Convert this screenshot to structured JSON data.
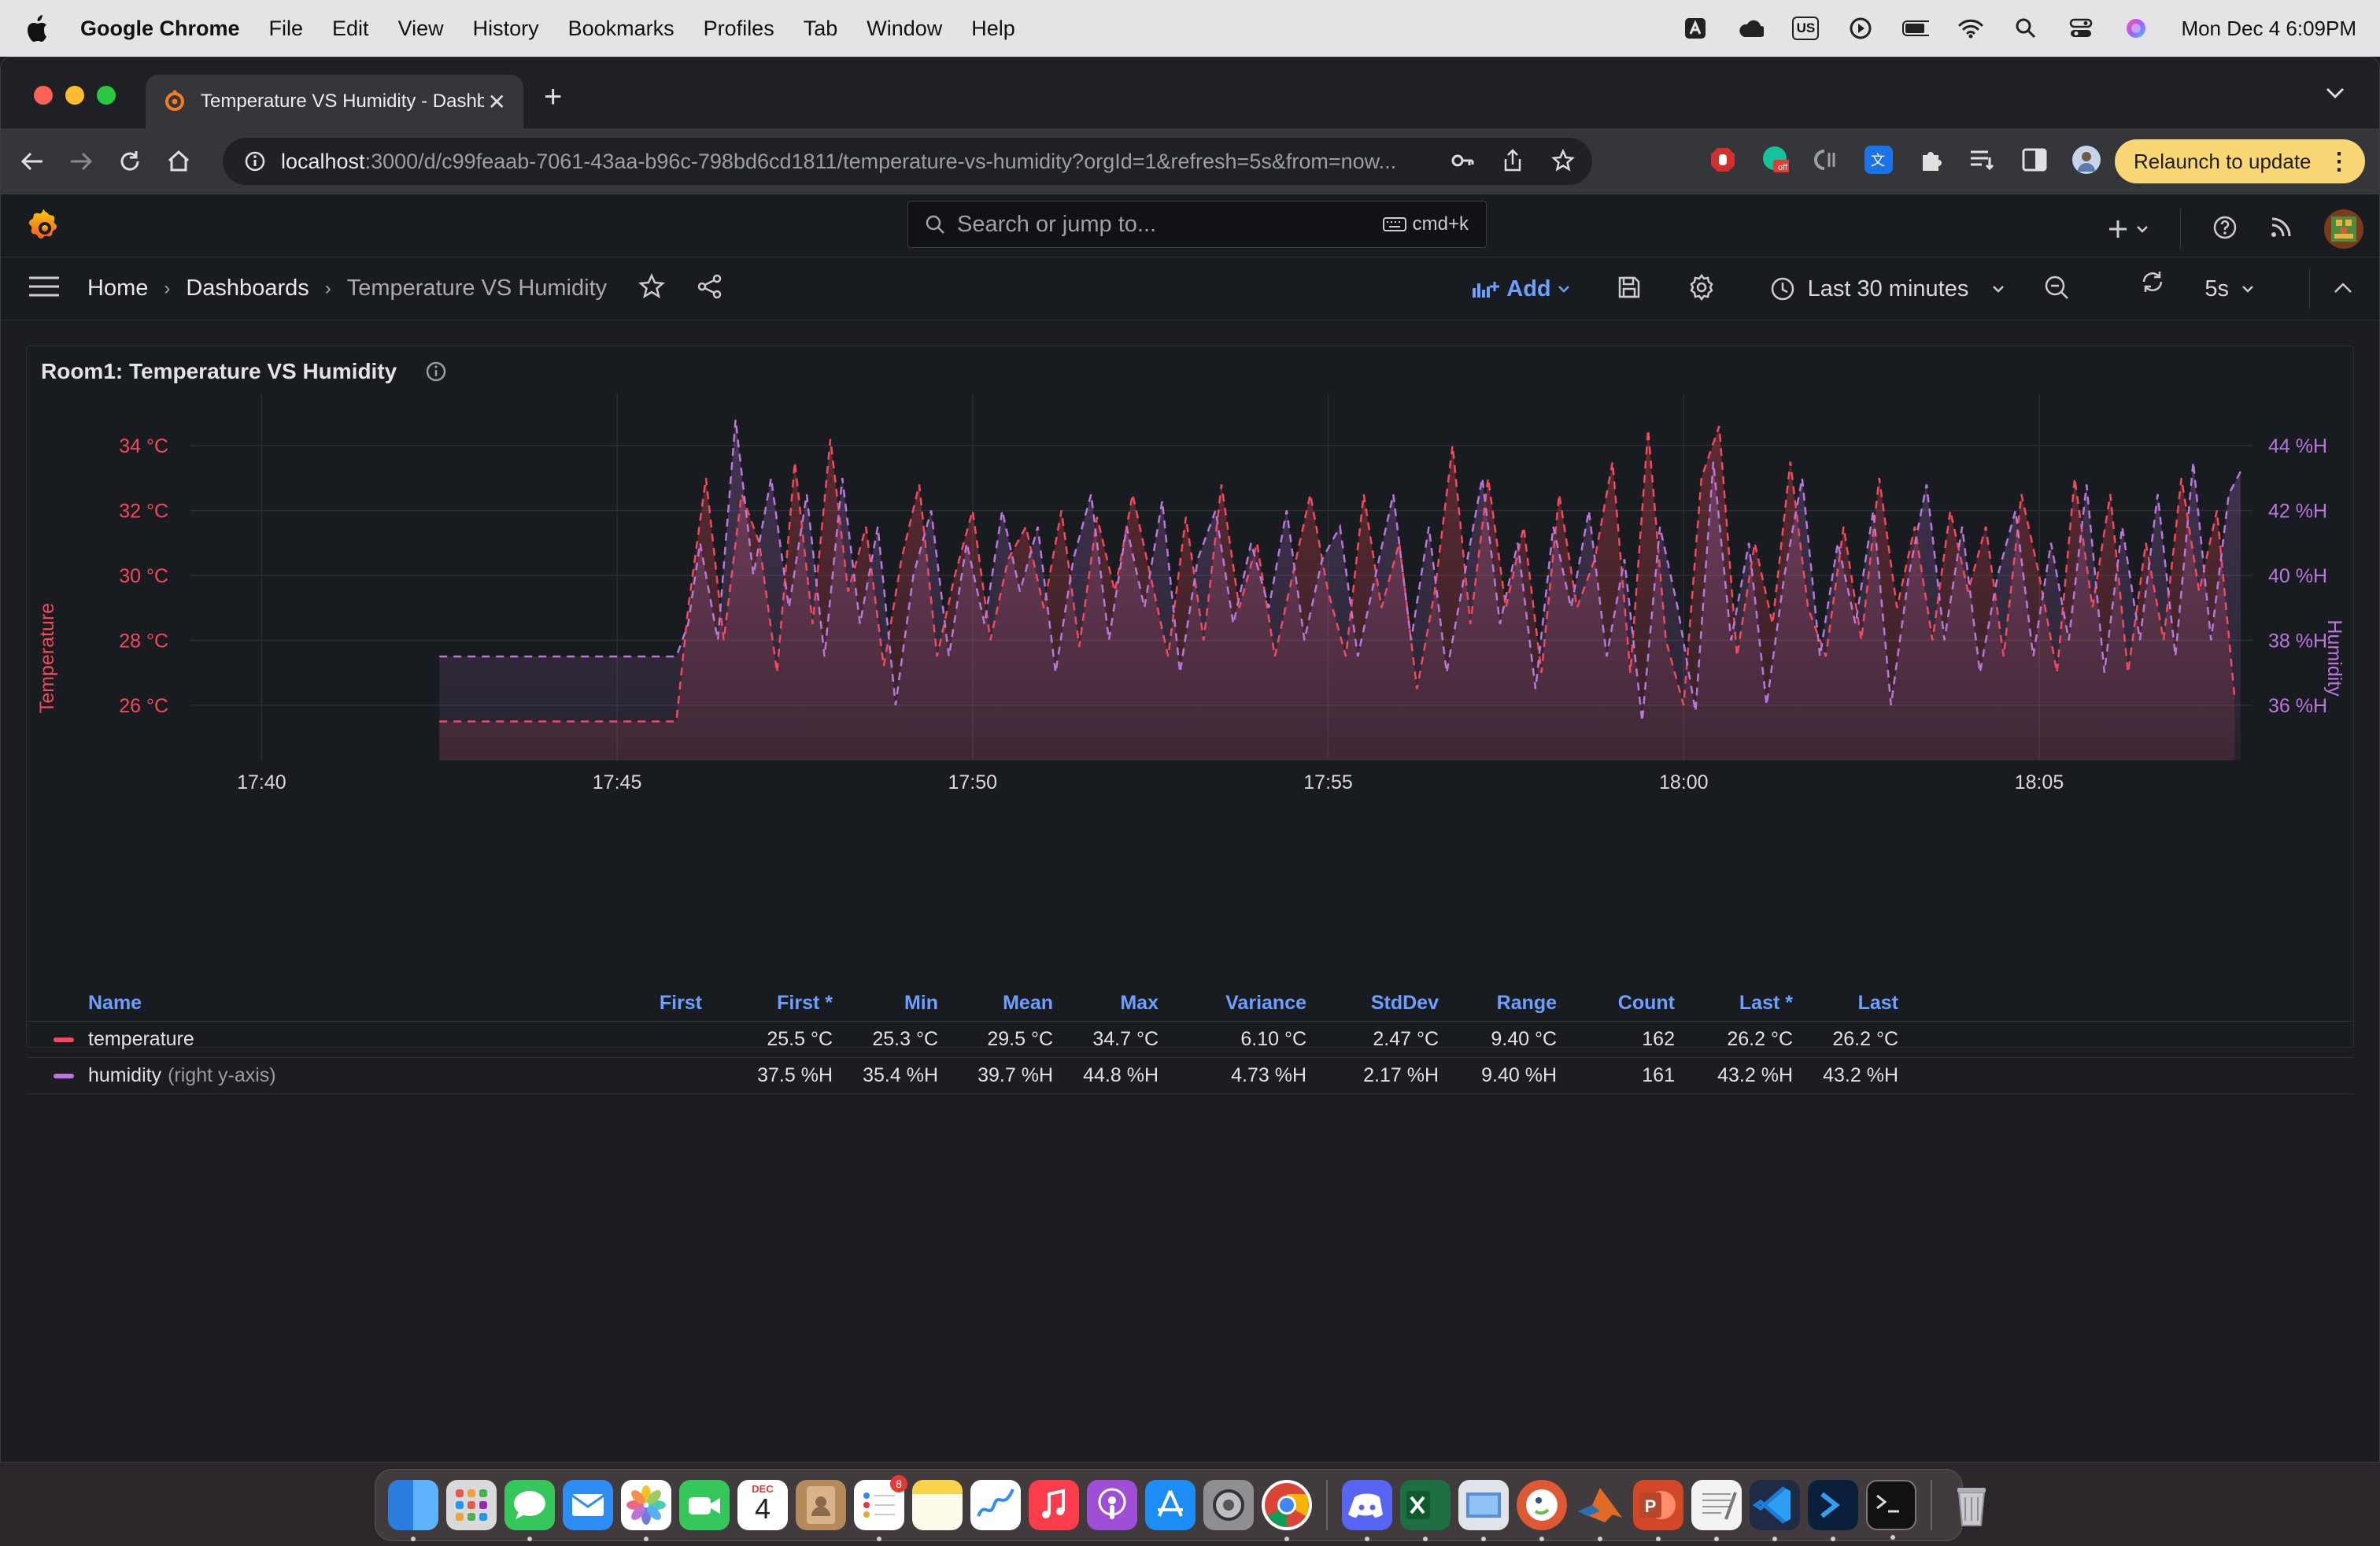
{
  "menubar": {
    "app_name": "Google Chrome",
    "items": [
      "File",
      "Edit",
      "View",
      "History",
      "Bookmarks",
      "Profiles",
      "Tab",
      "Window",
      "Help"
    ],
    "keyboard_layout": "US",
    "clock": "Mon Dec 4  6:09PM"
  },
  "browser": {
    "tab_title": "Temperature VS Humidity - Dashboards - Grafana",
    "url_host": "localhost",
    "url_rest": ":3000/d/c99feaab-7061-43aa-b96c-798bd6cd1811/temperature-vs-humidity?orgId=1&refresh=5s&from=now...",
    "relaunch_label": "Relaunch to update"
  },
  "grafana": {
    "search_placeholder": "Search or jump to...",
    "search_shortcut": "cmd+k",
    "breadcrumb": {
      "home": "Home",
      "dashboards": "Dashboards",
      "current": "Temperature VS Humidity"
    },
    "add_label": "Add",
    "time_range": "Last 30 minutes",
    "refresh_interval": "5s"
  },
  "panel": {
    "title": "Room1: Temperature VS Humidity"
  },
  "chart_data": {
    "type": "line",
    "left_axis": {
      "label": "Temperature",
      "ticks": [
        "34 °C",
        "32 °C",
        "30 °C",
        "28 °C",
        "26 °C"
      ],
      "tick_values": [
        34,
        32,
        30,
        28,
        26
      ],
      "range": [
        24.3,
        35.6
      ]
    },
    "right_axis": {
      "label": "Humidity",
      "ticks": [
        "44 %H",
        "42 %H",
        "40 %H",
        "38 %H",
        "36 %H"
      ],
      "tick_values": [
        44,
        42,
        40,
        38,
        36
      ],
      "range": [
        34.3,
        45.6
      ]
    },
    "x_ticks": [
      "17:40",
      "17:45",
      "17:50",
      "17:55",
      "18:00",
      "18:05"
    ],
    "x_range_minutes": [
      "17:39",
      "18:08"
    ],
    "legend_placement": "bottom",
    "series": [
      {
        "name": "temperature",
        "color": "#f2495c",
        "style": "dashed",
        "axis": "left",
        "points": [
          [
            "17:42:30",
            25.5
          ],
          [
            "17:45:50",
            25.5
          ],
          [
            "17:46:00",
            29.0
          ],
          [
            "17:46:15",
            33.0
          ],
          [
            "17:46:30",
            28.0
          ],
          [
            "17:46:45",
            32.5
          ],
          [
            "17:47:00",
            31.0
          ],
          [
            "17:47:15",
            27.0
          ],
          [
            "17:47:30",
            33.5
          ],
          [
            "17:47:45",
            28.5
          ],
          [
            "17:48:00",
            34.2
          ],
          [
            "17:48:15",
            29.5
          ],
          [
            "17:48:30",
            31.5
          ],
          [
            "17:48:45",
            27.2
          ],
          [
            "17:49:00",
            30.5
          ],
          [
            "17:49:15",
            32.8
          ],
          [
            "17:49:30",
            27.5
          ],
          [
            "17:49:45",
            30.0
          ],
          [
            "17:50:00",
            32.0
          ],
          [
            "17:50:15",
            28.0
          ],
          [
            "17:50:30",
            30.5
          ],
          [
            "17:50:45",
            31.5
          ],
          [
            "17:51:00",
            29.0
          ],
          [
            "17:51:15",
            32.0
          ],
          [
            "17:51:30",
            27.8
          ],
          [
            "17:51:45",
            31.8
          ],
          [
            "17:52:00",
            29.5
          ],
          [
            "17:52:15",
            32.5
          ],
          [
            "17:52:30",
            30.0
          ],
          [
            "17:52:45",
            27.5
          ],
          [
            "17:53:00",
            31.8
          ],
          [
            "17:53:15",
            28.0
          ],
          [
            "17:53:30",
            32.8
          ],
          [
            "17:53:45",
            29.0
          ],
          [
            "17:54:00",
            31.0
          ],
          [
            "17:54:15",
            27.5
          ],
          [
            "17:54:30",
            30.0
          ],
          [
            "17:54:45",
            32.5
          ],
          [
            "17:55:00",
            29.5
          ],
          [
            "17:55:15",
            27.5
          ],
          [
            "17:55:30",
            32.5
          ],
          [
            "17:55:45",
            29.0
          ],
          [
            "17:56:00",
            31.0
          ],
          [
            "17:56:15",
            26.5
          ],
          [
            "17:56:30",
            29.5
          ],
          [
            "17:56:45",
            34.0
          ],
          [
            "17:57:00",
            28.5
          ],
          [
            "17:57:15",
            33.0
          ],
          [
            "17:57:30",
            29.0
          ],
          [
            "17:57:45",
            31.5
          ],
          [
            "17:58:00",
            27.0
          ],
          [
            "17:58:15",
            32.5
          ],
          [
            "17:58:30",
            29.0
          ],
          [
            "17:58:45",
            30.5
          ],
          [
            "17:59:00",
            33.5
          ],
          [
            "17:59:15",
            27.0
          ],
          [
            "17:59:30",
            34.5
          ],
          [
            "17:59:45",
            28.0
          ],
          [
            "18:00:00",
            26.0
          ],
          [
            "18:00:15",
            33.0
          ],
          [
            "18:00:30",
            34.6
          ],
          [
            "18:00:45",
            27.5
          ],
          [
            "18:01:00",
            31.0
          ],
          [
            "18:01:15",
            28.5
          ],
          [
            "18:01:30",
            33.5
          ],
          [
            "18:01:45",
            29.0
          ],
          [
            "18:02:00",
            27.5
          ],
          [
            "18:02:15",
            31.5
          ],
          [
            "18:02:30",
            28.0
          ],
          [
            "18:02:45",
            33.0
          ],
          [
            "18:03:00",
            29.0
          ],
          [
            "18:03:15",
            31.5
          ],
          [
            "18:03:30",
            28.0
          ],
          [
            "18:03:45",
            32.0
          ],
          [
            "18:04:00",
            29.5
          ],
          [
            "18:04:15",
            31.5
          ],
          [
            "18:04:30",
            27.5
          ],
          [
            "18:04:45",
            32.5
          ],
          [
            "18:05:00",
            30.0
          ],
          [
            "18:05:15",
            27.0
          ],
          [
            "18:05:30",
            33.0
          ],
          [
            "18:05:45",
            29.0
          ],
          [
            "18:06:00",
            32.5
          ],
          [
            "18:06:15",
            27.0
          ],
          [
            "18:06:30",
            31.0
          ],
          [
            "18:06:45",
            28.0
          ],
          [
            "18:07:00",
            33.0
          ],
          [
            "18:07:15",
            29.5
          ],
          [
            "18:07:30",
            32.0
          ],
          [
            "18:07:45",
            26.2
          ]
        ]
      },
      {
        "name": "humidity",
        "color": "#b877d9",
        "style": "dashed",
        "axis": "right",
        "points": [
          [
            "17:42:30",
            37.5
          ],
          [
            "17:45:50",
            37.5
          ],
          [
            "17:46:00",
            38.5
          ],
          [
            "17:46:10",
            41.0
          ],
          [
            "17:46:25",
            38.0
          ],
          [
            "17:46:40",
            44.8
          ],
          [
            "17:46:55",
            40.0
          ],
          [
            "17:47:10",
            43.0
          ],
          [
            "17:47:25",
            39.0
          ],
          [
            "17:47:40",
            42.5
          ],
          [
            "17:47:55",
            37.5
          ],
          [
            "17:48:10",
            43.0
          ],
          [
            "17:48:25",
            38.5
          ],
          [
            "17:48:40",
            41.5
          ],
          [
            "17:48:55",
            36.0
          ],
          [
            "17:49:10",
            40.0
          ],
          [
            "17:49:25",
            42.0
          ],
          [
            "17:49:40",
            37.5
          ],
          [
            "17:49:55",
            41.0
          ],
          [
            "17:50:10",
            38.5
          ],
          [
            "17:50:25",
            42.0
          ],
          [
            "17:50:40",
            39.5
          ],
          [
            "17:50:55",
            41.5
          ],
          [
            "17:51:10",
            37.0
          ],
          [
            "17:51:25",
            40.5
          ],
          [
            "17:51:40",
            42.5
          ],
          [
            "17:51:55",
            38.0
          ],
          [
            "17:52:10",
            41.5
          ],
          [
            "17:52:25",
            39.0
          ],
          [
            "17:52:40",
            42.3
          ],
          [
            "17:52:55",
            37.0
          ],
          [
            "17:53:10",
            40.5
          ],
          [
            "17:53:25",
            42.0
          ],
          [
            "17:53:40",
            38.5
          ],
          [
            "17:53:55",
            41.0
          ],
          [
            "17:54:10",
            39.0
          ],
          [
            "17:54:25",
            42.0
          ],
          [
            "17:54:40",
            38.0
          ],
          [
            "17:54:55",
            40.5
          ],
          [
            "17:55:10",
            41.5
          ],
          [
            "17:55:25",
            37.5
          ],
          [
            "17:55:40",
            40.0
          ],
          [
            "17:55:55",
            42.5
          ],
          [
            "17:56:10",
            38.0
          ],
          [
            "17:56:25",
            41.5
          ],
          [
            "17:56:40",
            37.0
          ],
          [
            "17:56:55",
            40.0
          ],
          [
            "17:57:10",
            43.0
          ],
          [
            "17:57:25",
            38.5
          ],
          [
            "17:57:40",
            41.0
          ],
          [
            "17:57:55",
            36.5
          ],
          [
            "17:58:10",
            41.5
          ],
          [
            "17:58:25",
            39.0
          ],
          [
            "17:58:40",
            42.0
          ],
          [
            "17:58:55",
            37.5
          ],
          [
            "17:59:10",
            40.5
          ],
          [
            "17:59:25",
            35.5
          ],
          [
            "17:59:40",
            41.5
          ],
          [
            "17:59:55",
            39.0
          ],
          [
            "18:00:10",
            35.8
          ],
          [
            "18:00:25",
            43.5
          ],
          [
            "18:00:40",
            38.0
          ],
          [
            "18:00:55",
            41.0
          ],
          [
            "18:01:10",
            36.0
          ],
          [
            "18:01:25",
            40.0
          ],
          [
            "18:01:40",
            43.0
          ],
          [
            "18:01:55",
            37.5
          ],
          [
            "18:02:10",
            41.0
          ],
          [
            "18:02:25",
            38.5
          ],
          [
            "18:02:40",
            42.0
          ],
          [
            "18:02:55",
            36.0
          ],
          [
            "18:03:10",
            40.0
          ],
          [
            "18:03:25",
            42.8
          ],
          [
            "18:03:40",
            38.0
          ],
          [
            "18:03:55",
            41.5
          ],
          [
            "18:04:10",
            37.0
          ],
          [
            "18:04:25",
            40.0
          ],
          [
            "18:04:40",
            42.0
          ],
          [
            "18:04:55",
            37.5
          ],
          [
            "18:05:10",
            41.0
          ],
          [
            "18:05:25",
            38.0
          ],
          [
            "18:05:40",
            42.8
          ],
          [
            "18:05:55",
            37.0
          ],
          [
            "18:06:10",
            41.5
          ],
          [
            "18:06:25",
            38.0
          ],
          [
            "18:06:40",
            42.5
          ],
          [
            "18:06:55",
            37.5
          ],
          [
            "18:07:10",
            43.5
          ],
          [
            "18:07:25",
            38.0
          ],
          [
            "18:07:40",
            42.5
          ],
          [
            "18:07:50",
            43.2
          ]
        ]
      }
    ]
  },
  "legend": {
    "columns": [
      "Name",
      "First",
      "First *",
      "Min",
      "Mean",
      "Max",
      "Variance",
      "StdDev",
      "Range",
      "Count",
      "Last *",
      "Last"
    ],
    "rows": [
      {
        "name": "temperature",
        "axis_note": "",
        "color": "#f2495c",
        "values": [
          "",
          "25.5 °C",
          "25.3 °C",
          "29.5 °C",
          "34.7 °C",
          "6.10 °C",
          "2.47 °C",
          "9.40 °C",
          "162",
          "26.2 °C",
          "26.2 °C"
        ]
      },
      {
        "name": "humidity",
        "axis_note": "(right y-axis)",
        "color": "#b877d9",
        "values": [
          "",
          "37.5 %H",
          "35.4 %H",
          "39.7 %H",
          "44.8 %H",
          "4.73 %H",
          "2.17 %H",
          "9.40 %H",
          "161",
          "43.2 %H",
          "43.2 %H"
        ]
      }
    ]
  },
  "dock": {
    "calendar_month": "DEC",
    "calendar_day": "4",
    "reminders_badge": "8"
  }
}
